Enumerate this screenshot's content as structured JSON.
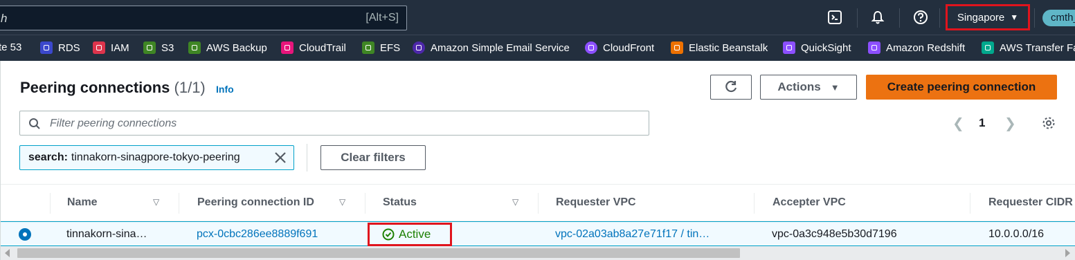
{
  "topbar": {
    "search_placeholder": "h",
    "search_shortcut": "[Alt+S]",
    "region": "Singapore",
    "account": "cmth_"
  },
  "favorites": [
    {
      "label": "te 53",
      "color": ""
    },
    {
      "label": "RDS",
      "color": "#3b48cc"
    },
    {
      "label": "IAM",
      "color": "#dd344c"
    },
    {
      "label": "S3",
      "color": "#3f8624"
    },
    {
      "label": "AWS Backup",
      "color": "#3f8624"
    },
    {
      "label": "CloudTrail",
      "color": "#e7157b"
    },
    {
      "label": "EFS",
      "color": "#3f8624"
    },
    {
      "label": "Amazon Simple Email Service",
      "color": "#4d27aa"
    },
    {
      "label": "CloudFront",
      "color": "#8c4fff"
    },
    {
      "label": "Elastic Beanstalk",
      "color": "#ed7100"
    },
    {
      "label": "QuickSight",
      "color": "#8c4fff"
    },
    {
      "label": "Amazon Redshift",
      "color": "#8c4fff"
    },
    {
      "label": "AWS Transfer Fa",
      "color": "#01a88d"
    }
  ],
  "header": {
    "title": "Peering connections",
    "count": "(1/1)",
    "info": "Info",
    "actions_label": "Actions",
    "create_label": "Create peering connection"
  },
  "filter": {
    "placeholder": "Filter peering connections",
    "token_key": "search:",
    "token_value": "tinnakorn-sinagpore-tokyo-peering",
    "clear_label": "Clear filters"
  },
  "pagination": {
    "current_page": "1"
  },
  "table": {
    "columns": [
      "Name",
      "Peering connection ID",
      "Status",
      "Requester VPC",
      "Accepter VPC",
      "Requester CIDR"
    ],
    "rows": [
      {
        "name": "tinnakorn-sina…",
        "peering_id": "pcx-0cbc286ee8889f691",
        "status": "Active",
        "requester_vpc": "vpc-02a03ab8a27e71f17 / tin…",
        "accepter_vpc": "vpc-0a3c948e5b30d7196",
        "requester_cidr": "10.0.0.0/16"
      }
    ]
  },
  "colors": {
    "nav_bg": "#232f3e",
    "primary": "#ec7211",
    "link": "#0073bb",
    "success": "#1d8102",
    "highlight": "#e0141d"
  }
}
